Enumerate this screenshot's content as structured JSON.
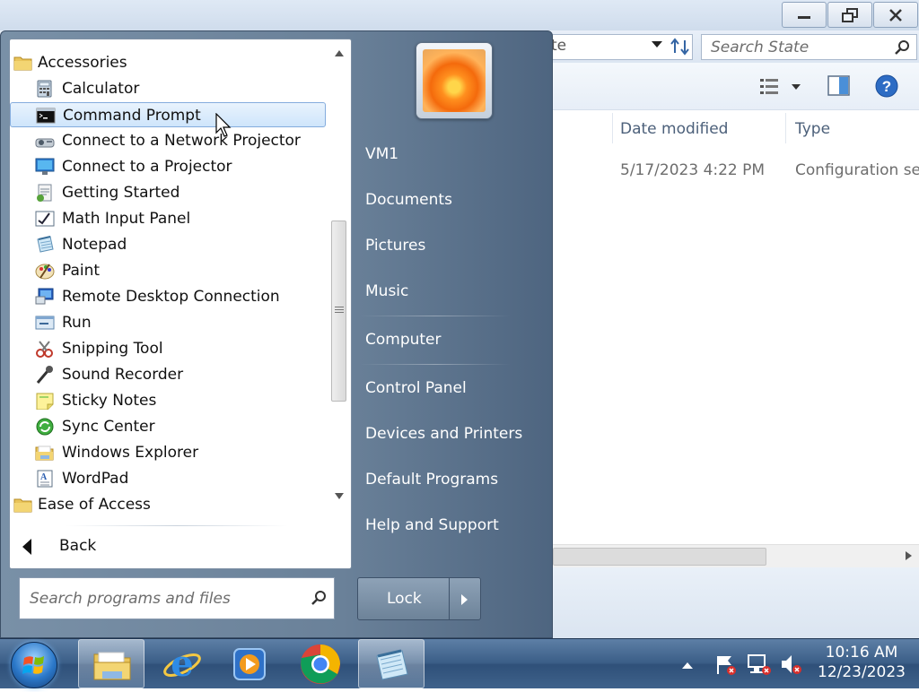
{
  "explorer": {
    "address_text": "te",
    "search_placeholder": "Search State",
    "columns": [
      "Date modified",
      "Type"
    ],
    "row": {
      "date": "5/17/2023 4:22 PM",
      "type": "Configuration set"
    }
  },
  "start_menu": {
    "programs": [
      {
        "label": "Accessories",
        "icon": "folder-icon",
        "folder": true
      },
      {
        "label": "Calculator",
        "icon": "calculator-icon"
      },
      {
        "label": "Command Prompt",
        "icon": "command-prompt-icon",
        "selected": true
      },
      {
        "label": "Connect to a Network Projector",
        "icon": "network-projector-icon"
      },
      {
        "label": "Connect to a Projector",
        "icon": "projector-icon"
      },
      {
        "label": "Getting Started",
        "icon": "getting-started-icon"
      },
      {
        "label": "Math Input Panel",
        "icon": "math-input-icon"
      },
      {
        "label": "Notepad",
        "icon": "notepad-icon"
      },
      {
        "label": "Paint",
        "icon": "paint-icon"
      },
      {
        "label": "Remote Desktop Connection",
        "icon": "remote-desktop-icon"
      },
      {
        "label": "Run",
        "icon": "run-icon"
      },
      {
        "label": "Snipping Tool",
        "icon": "snipping-tool-icon"
      },
      {
        "label": "Sound Recorder",
        "icon": "microphone-icon"
      },
      {
        "label": "Sticky Notes",
        "icon": "sticky-notes-icon"
      },
      {
        "label": "Sync Center",
        "icon": "sync-center-icon"
      },
      {
        "label": "Windows Explorer",
        "icon": "windows-explorer-icon"
      },
      {
        "label": "WordPad",
        "icon": "wordpad-icon"
      },
      {
        "label": "Ease of Access",
        "icon": "folder-icon",
        "folder": true
      }
    ],
    "back_label": "Back",
    "search_placeholder": "Search programs and files",
    "right_items": [
      "VM1",
      "Documents",
      "Pictures",
      "Music",
      "Computer",
      "Control Panel",
      "Devices and Printers",
      "Default Programs",
      "Help and Support"
    ],
    "lock_label": "Lock"
  },
  "taskbar": {
    "items": [
      "windows-explorer",
      "internet-explorer",
      "windows-media-player",
      "google-chrome",
      "notepad"
    ],
    "clock_time": "10:16 AM",
    "clock_date": "12/23/2023"
  }
}
